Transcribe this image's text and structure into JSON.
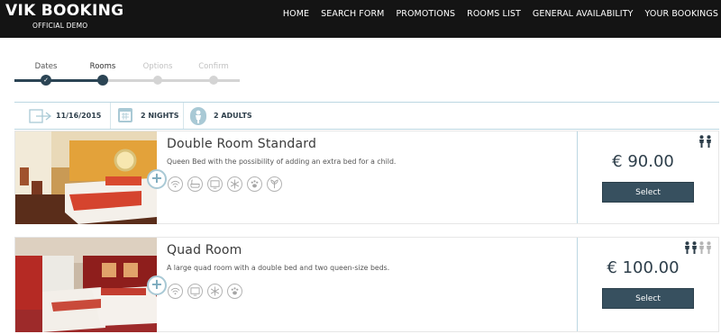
{
  "header": {
    "title": "VIK BOOKING",
    "subtitle": "OFFICIAL DEMO",
    "nav": [
      "HOME",
      "SEARCH FORM",
      "PROMOTIONS",
      "ROOMS LIST",
      "GENERAL AVAILABILITY",
      "YOUR BOOKINGS"
    ]
  },
  "steps": [
    {
      "label": "Dates",
      "state": "done"
    },
    {
      "label": "Rooms",
      "state": "active"
    },
    {
      "label": "Options",
      "state": "todo"
    },
    {
      "label": "Confirm",
      "state": "todo"
    }
  ],
  "summary": {
    "date": "11/16/2015",
    "nights": "2 NIGHTS",
    "adults": "2 ADULTS"
  },
  "rooms": [
    {
      "name": "Double Room Standard",
      "description": "Queen Bed with the possibility of adding an extra bed for a child.",
      "price": "€ 90.00",
      "select_label": "Select",
      "amenities": [
        "wifi-icon",
        "bathtub-icon",
        "tv-icon",
        "air-conditioning-icon",
        "pets-icon",
        "garden-icon"
      ],
      "guests_icon": "two-persons-icon"
    },
    {
      "name": "Quad Room",
      "description": "A large quad room with a double bed and two queen-size beds.",
      "price": "€ 100.00",
      "select_label": "Select",
      "amenities": [
        "wifi-icon",
        "tv-icon",
        "air-conditioning-icon",
        "pets-icon"
      ],
      "guests_icon": "four-persons-icon"
    }
  ],
  "colors": {
    "header_bg": "#141414",
    "accent": "#2b4454",
    "button": "#37505f",
    "border_blue": "#bcd7e2"
  }
}
